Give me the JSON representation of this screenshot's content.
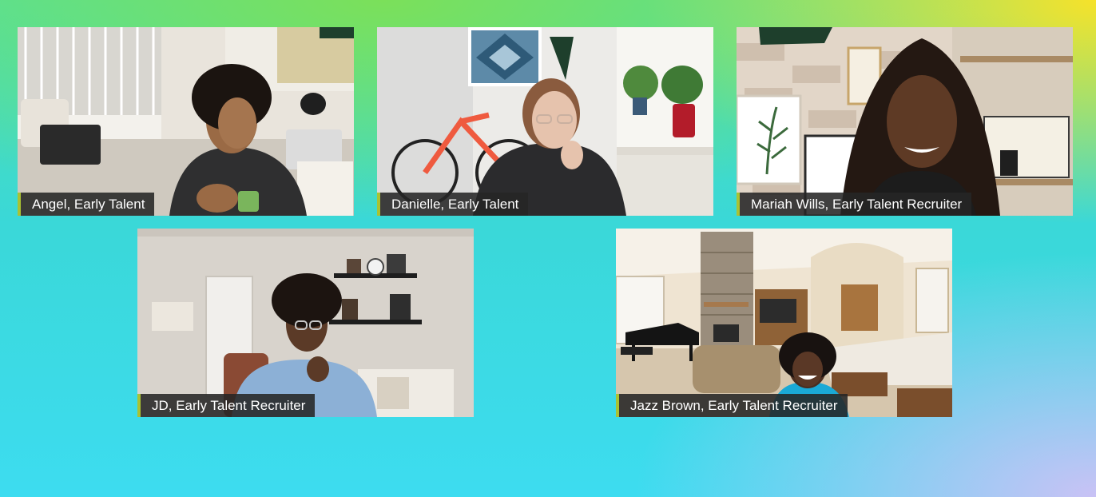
{
  "participants": [
    {
      "name": "Angel, Early Talent"
    },
    {
      "name": "Danielle, Early Talent"
    },
    {
      "name": "Mariah Wills, Early Talent Recruiter"
    },
    {
      "name": "JD, Early Talent Recruiter"
    },
    {
      "name": "Jazz Brown, Early Talent Recruiter"
    }
  ],
  "colors": {
    "label_background": "#262626",
    "label_accent": "#a9c233",
    "label_text": "#ffffff"
  }
}
